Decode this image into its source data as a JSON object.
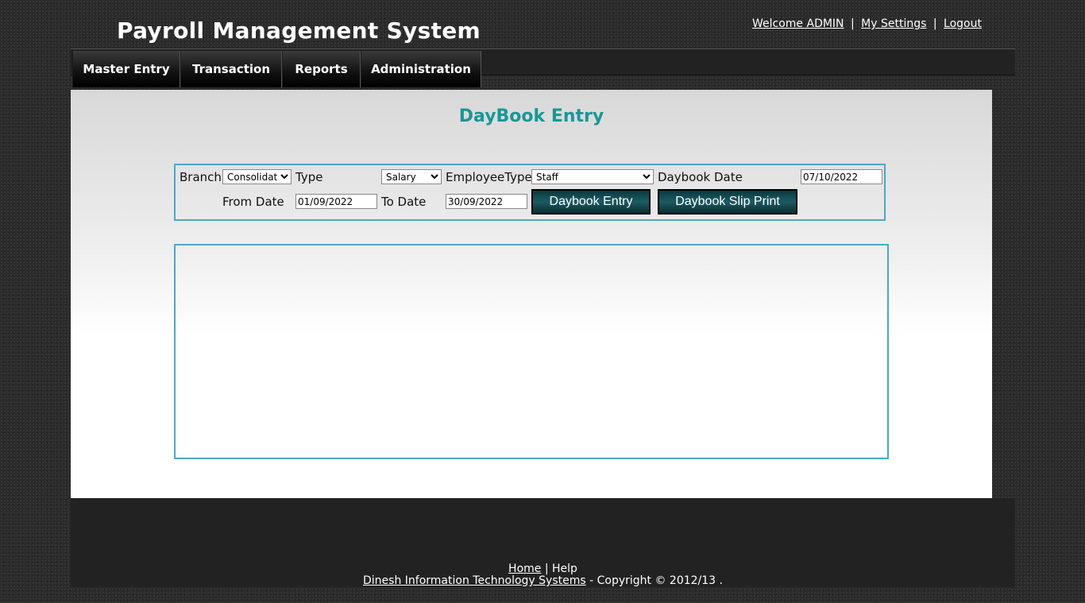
{
  "header": {
    "app_title": "Payroll Management System",
    "welcome": "Welcome ADMIN",
    "my_settings": "My Settings",
    "logout": "Logout",
    "separator": "|"
  },
  "nav": {
    "items": [
      {
        "label": "Master Entry"
      },
      {
        "label": "Transaction"
      },
      {
        "label": "Reports"
      },
      {
        "label": "Administration"
      }
    ]
  },
  "page": {
    "title": "DayBook Entry"
  },
  "filters": {
    "branch_label": "Branch",
    "branch_value": "Consolidated",
    "type_label": "Type",
    "type_value": "Salary",
    "employee_type_label": "EmployeeType",
    "employee_type_value": "Staff",
    "daybook_date_label": "Daybook Date",
    "daybook_date_value": "07/10/2022",
    "from_date_label": "From Date",
    "from_date_value": "01/09/2022",
    "to_date_label": "To Date",
    "to_date_value": "30/09/2022",
    "daybook_entry_button": "Daybook Entry",
    "daybook_slip_print_button": "Daybook Slip Print"
  },
  "footer": {
    "home": "Home",
    "separator": "|",
    "help": "Help",
    "company": "Dinesh Information Technology Systems",
    "copyright": "- Copyright © 2012/13 ."
  },
  "colors": {
    "accent": "#1a9696",
    "box_border": "#4aa8c8",
    "button": "#1d5b63"
  }
}
